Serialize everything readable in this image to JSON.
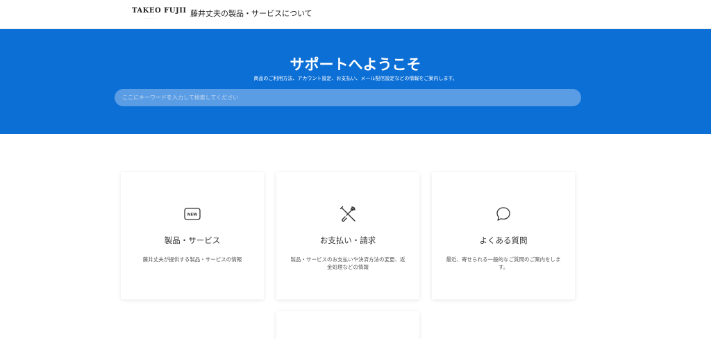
{
  "header": {
    "logo_text": "TAKEO FUJII",
    "about_link": "藤井丈夫の製品・サービスについて"
  },
  "hero": {
    "title": "サポートへようこそ",
    "subtitle": "商品のご利用方法、アカウント設定、お支払い、メール配信設定などの情報をご案内します。",
    "search_placeholder": "ここにキーワードを入力して検索してください",
    "background_color": "#0b6fd6"
  },
  "categories": [
    {
      "icon": "new-badge-icon",
      "title": "製品・サービス",
      "description": "藤井丈夫が提供する製品・サービスの情報"
    },
    {
      "icon": "tools-icon",
      "title": "お支払い・請求",
      "description": "製品・サービスのお支払いや決済方法の変更、返金処理などの情報"
    },
    {
      "icon": "speech-bubble-icon",
      "title": "よくある質問",
      "description": "最近、寄せられる一般的なご質問のご案内をします。"
    }
  ]
}
